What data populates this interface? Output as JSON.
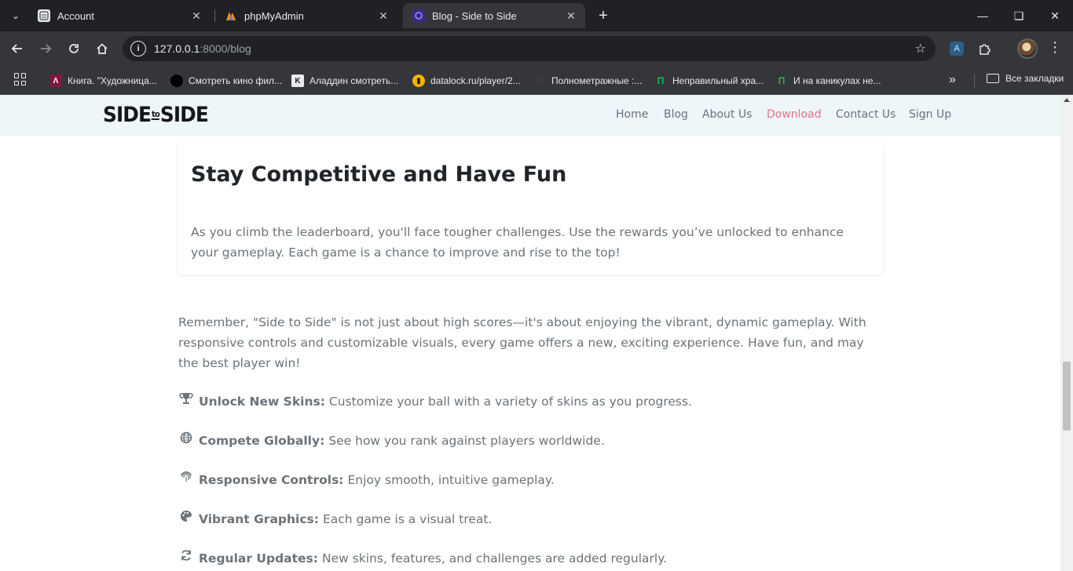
{
  "browser": {
    "tabs": [
      {
        "title": "Account",
        "favicon": "account-favicon"
      },
      {
        "title": "phpMyAdmin",
        "favicon": "phpmyadmin-favicon"
      },
      {
        "title": "Blog - Side to Side",
        "favicon": "site-favicon"
      }
    ],
    "url_host": "127.0.0.1",
    "url_rest": ":8000/blog",
    "bookmarks": [
      {
        "label": "Книга. \"Художница...",
        "icon": "book-icon",
        "color": "#7a1a3d"
      },
      {
        "label": "Смотреть кино фил...",
        "icon": "film-icon",
        "color": "#000000"
      },
      {
        "label": "Аладдин смотреть...",
        "icon": "k-icon",
        "color": "#e8eaed"
      },
      {
        "label": "datalock.ru/player/2...",
        "icon": "player-icon",
        "color": "#f4b400"
      },
      {
        "label": "Полнометражные :...",
        "icon": "m-icon",
        "color": "#3c3c3c"
      },
      {
        "label": "Неправильный хра...",
        "icon": "p-icon",
        "color": "#1db954"
      },
      {
        "label": "И на каникулах не...",
        "icon": "p-icon",
        "color": "#1db954"
      }
    ],
    "all_bookmarks": "Все закладки"
  },
  "site": {
    "logo_left": "SIDE",
    "logo_mid": "to",
    "logo_right": "SIDE",
    "nav": [
      "Home",
      "Blog",
      "About Us",
      "Download",
      "Contact Us",
      "Sign Up"
    ],
    "active_nav": "Download",
    "accent_color": "#e76f86"
  },
  "article": {
    "card_title": "Stay Competitive and Have Fun",
    "card_text": "As you climb the leaderboard, you'll face tougher challenges. Use the rewards you’ve unlocked to enhance your gameplay. Each game is a chance to improve and rise to the top!",
    "paragraph": "Remember, \"Side to Side\" is not just about high scores—it's about enjoying the vibrant, dynamic gameplay. With responsive controls and customizable visuals, every game offers a new, exciting experience. Have fun, and may the best player win!",
    "features": [
      {
        "icon": "trophy-icon",
        "label": "Unlock New Skins:",
        "text": "Customize your ball with a variety of skins as you progress."
      },
      {
        "icon": "globe-icon",
        "label": "Compete Globally:",
        "text": "See how you rank against players worldwide."
      },
      {
        "icon": "fingerprint-icon",
        "label": "Responsive Controls:",
        "text": "Enjoy smooth, intuitive gameplay."
      },
      {
        "icon": "palette-icon",
        "label": "Vibrant Graphics:",
        "text": "Each game is a visual treat."
      },
      {
        "icon": "sync-icon",
        "label": "Regular Updates:",
        "text": "New skins, features, and challenges are added regularly."
      }
    ]
  }
}
